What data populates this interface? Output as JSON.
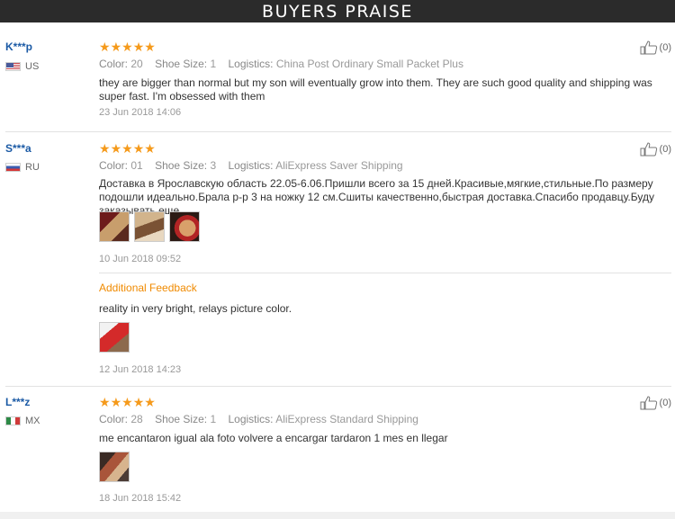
{
  "banner": {
    "title": "BUYERS PRAISE"
  },
  "labels": {
    "color": "Color:",
    "shoe_size": "Shoe Size:",
    "logistics": "Logistics:",
    "additional_feedback": "Additional Feedback"
  },
  "colors": {
    "star": "#f59a1b",
    "username": "#1b5aa5",
    "feedback_label": "#f08a00",
    "banner_bg": "#2b2b2b"
  },
  "reviews": [
    {
      "user": "K***p",
      "country_code": "US",
      "rating": 5,
      "like_count": "(0)",
      "color": "20",
      "shoe_size": "1",
      "logistics": "China Post Ordinary Small Packet Plus",
      "text": "they are bigger than normal but my son will eventually grow into them. They are such good quality and shipping was super fast. I'm obsessed with them",
      "date": "23 Jun 2018 14:06"
    },
    {
      "user": "S***a",
      "country_code": "RU",
      "rating": 5,
      "like_count": "(0)",
      "color": "01",
      "shoe_size": "3",
      "logistics": "AliExpress Saver Shipping",
      "text": "Доставка в Ярославскую область 22.05-6.06.Пришли всего за 15 дней.Красивые,мягкие,стильные.По размеру подошли идеально.Брала р-р 3 на ножку 12 см.Сшиты качественно,быстрая доставка.Спасибо продавцу.Буду заказывать еще.",
      "date": "10 Jun 2018 09:52",
      "additional": {
        "text": "reality in very bright, relays picture color.",
        "date": "12 Jun 2018 14:23"
      }
    },
    {
      "user": "L***z",
      "country_code": "MX",
      "rating": 5,
      "like_count": "(0)",
      "color": "28",
      "shoe_size": "1",
      "logistics": "AliExpress Standard Shipping",
      "text": "me encantaron igual ala foto volvere a encargar tardaron 1 mes en llegar",
      "date": "18 Jun 2018 15:42"
    }
  ]
}
